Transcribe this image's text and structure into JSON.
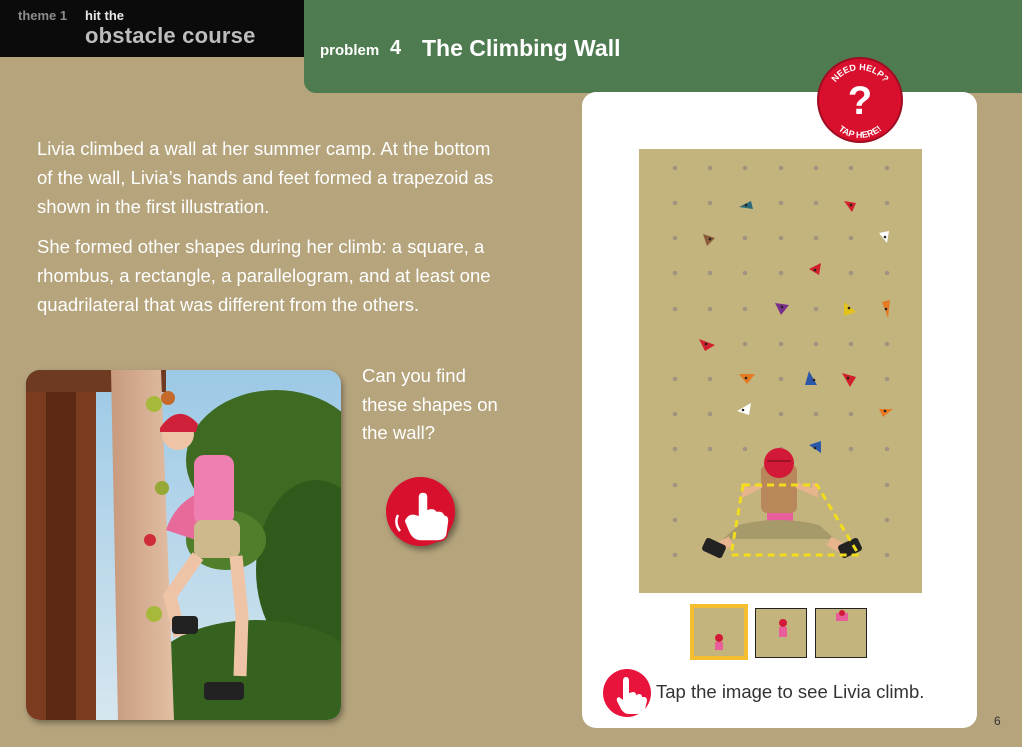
{
  "header": {
    "theme_number": "theme 1",
    "theme_kicker": "hit the",
    "theme_title": "obstacle course",
    "problem_label": "problem",
    "problem_number": "4",
    "problem_title": "The Climbing Wall"
  },
  "content": {
    "paragraph1": "Livia climbed a wall at her summer camp. At the bottom of the wall, Livia’s hands and feet formed a trapezoid as shown in the first illustration.",
    "paragraph2": "She formed other shapes during her climb: a square, a rhombus, a rectangle, a parallelogram, and at least one quadrilateral that was different from the others.",
    "question": "Can you find these shapes on the wall?"
  },
  "help_badge": {
    "top_text": "NEED HELP?",
    "bottom_text": "TAP HERE!"
  },
  "hint": "Tap the image to see Livia climb.",
  "page_number": "6",
  "thumbnails": [
    "illustration-1",
    "illustration-2",
    "illustration-3"
  ],
  "colors": {
    "page_background": "#b5a47c",
    "header_green": "#4e7b50",
    "header_black": "#0b0b0b",
    "accent_red": "#d8102d",
    "wall_tan": "#c3b37d",
    "thumbnail_highlight": "#f5be2e",
    "trapezoid_yellow": "#f1dd1b"
  },
  "icons": {
    "tap_button": "tapping-hand-icon",
    "help": "question-mark-icon",
    "hint": "pointing-hand-icon"
  }
}
